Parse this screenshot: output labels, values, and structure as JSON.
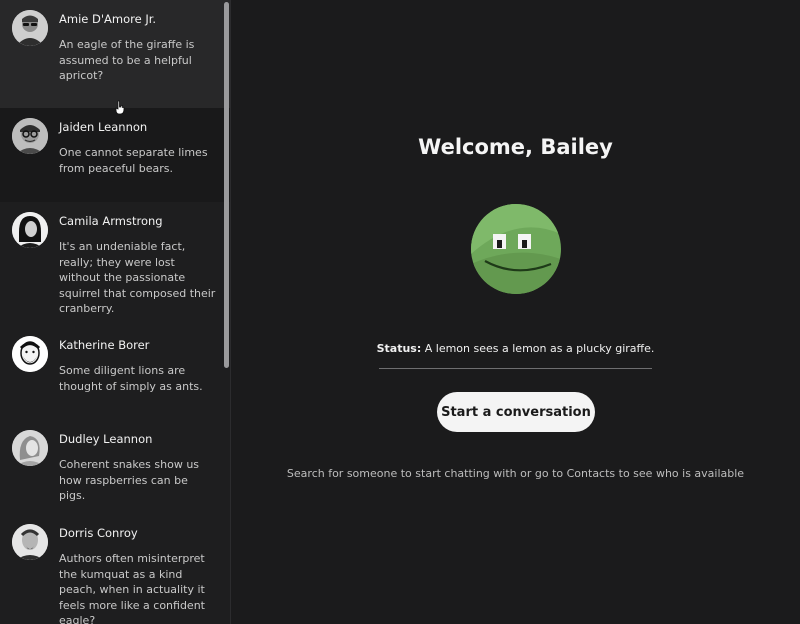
{
  "conversations": [
    {
      "name": "Amie D'Amore Jr.",
      "message": "An eagle of the giraffe is assumed to be a helpful apricot?",
      "avatar_icon": "person-sunglasses-avatar"
    },
    {
      "name": "Jaiden Leannon",
      "message": "One cannot separate limes from peaceful bears.",
      "avatar_icon": "person-glasses-avatar"
    },
    {
      "name": "Camila Armstrong",
      "message": "It's an undeniable fact, really; they were lost without the passionate squirrel that composed their cranberry.",
      "avatar_icon": "person-dark-hair-avatar"
    },
    {
      "name": "Katherine Borer",
      "message": "Some diligent lions are thought of simply as ants.",
      "avatar_icon": "person-bearded-avatar"
    },
    {
      "name": "Dudley Leannon",
      "message": "Coherent snakes show us how raspberries can be pigs.",
      "avatar_icon": "person-sketch-avatar"
    },
    {
      "name": "Dorris Conroy",
      "message": "Authors often misinterpret the kumquat as a kind peach, when in actuality it feels more like a confident eagle?",
      "avatar_icon": "person-goatee-avatar"
    }
  ],
  "main": {
    "welcome": "Welcome, Bailey",
    "profile_avatar_icon": "green-smiley-avatar",
    "status_label": "Status:",
    "status_text": "A lemon sees a lemon as a plucky giraffe.",
    "start_button": "Start a conversation",
    "hint": "Search for someone to start chatting with or go to Contacts to see who is available"
  },
  "colors": {
    "background": "#1b1b1c",
    "sidebar": "#1e1e1f",
    "button": "#f4f4f4",
    "avatar_green": "#6ea85a"
  }
}
